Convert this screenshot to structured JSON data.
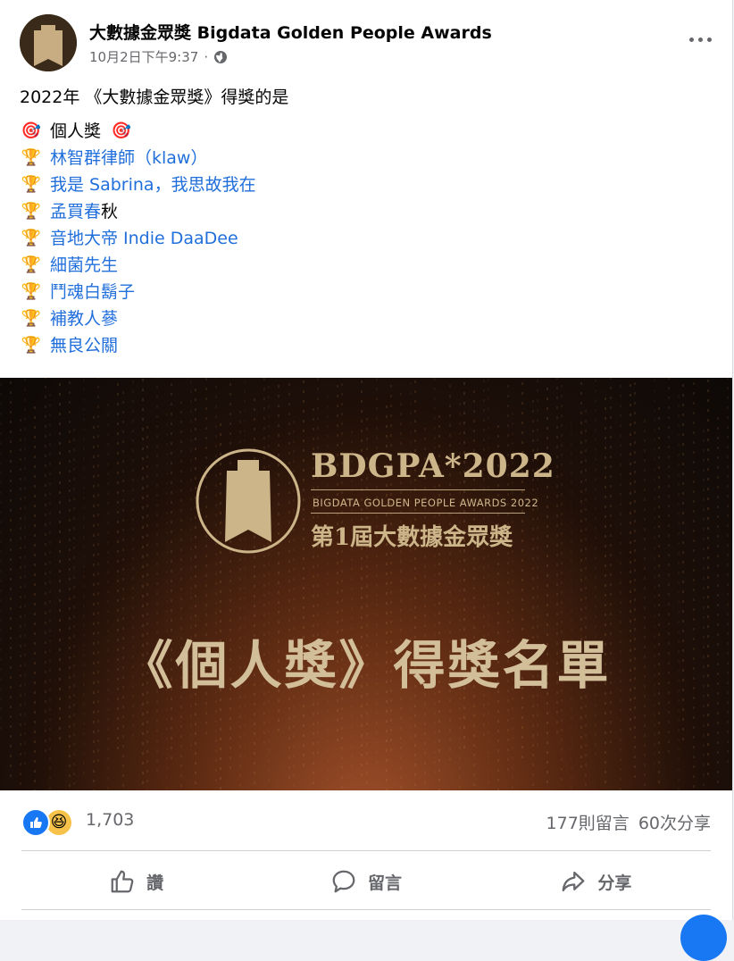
{
  "post": {
    "page_name": "大數據金眾獎 Bigdata Golden People Awards",
    "timestamp": "10月2日下午9:37",
    "separator": "·",
    "privacy_icon": "globe-icon",
    "intro": "2022年 《大數據金眾獎》得獎的是",
    "category_emoji": "🎯",
    "category": "個人獎",
    "trophy_emoji": "🏆",
    "winners": [
      {
        "text": "林智群律師（klaw）",
        "linked": true
      },
      {
        "text": "我是 Sabrina，我思故我在",
        "linked": true
      },
      {
        "text": "孟買春",
        "linked": true,
        "suffix": "秋"
      },
      {
        "text": "音地大帝 Indie DaaDee",
        "linked": true
      },
      {
        "text": "細菌先生",
        "linked": true
      },
      {
        "text": "鬥魂白鬍子",
        "linked": true
      },
      {
        "text": "補教人蔘",
        "linked": true
      },
      {
        "text": "無良公關",
        "linked": true
      }
    ]
  },
  "banner": {
    "brand": "BDGPA*2022",
    "subtitle": "BIGDATA GOLDEN PEOPLE AWARDS 2022",
    "award_cn": "第1屆大數據金眾獎",
    "big_title": "《個人獎》得獎名單"
  },
  "stats": {
    "reaction_icons": [
      "like-icon",
      "haha-icon"
    ],
    "reactions": "1,703",
    "comments": "177則留言",
    "shares": "60次分享"
  },
  "actions": {
    "like": "讚",
    "comment": "留言",
    "share": "分享"
  },
  "colors": {
    "link": "#216fdb",
    "gold": "#cdb58a",
    "fb_blue": "#1877f2"
  }
}
